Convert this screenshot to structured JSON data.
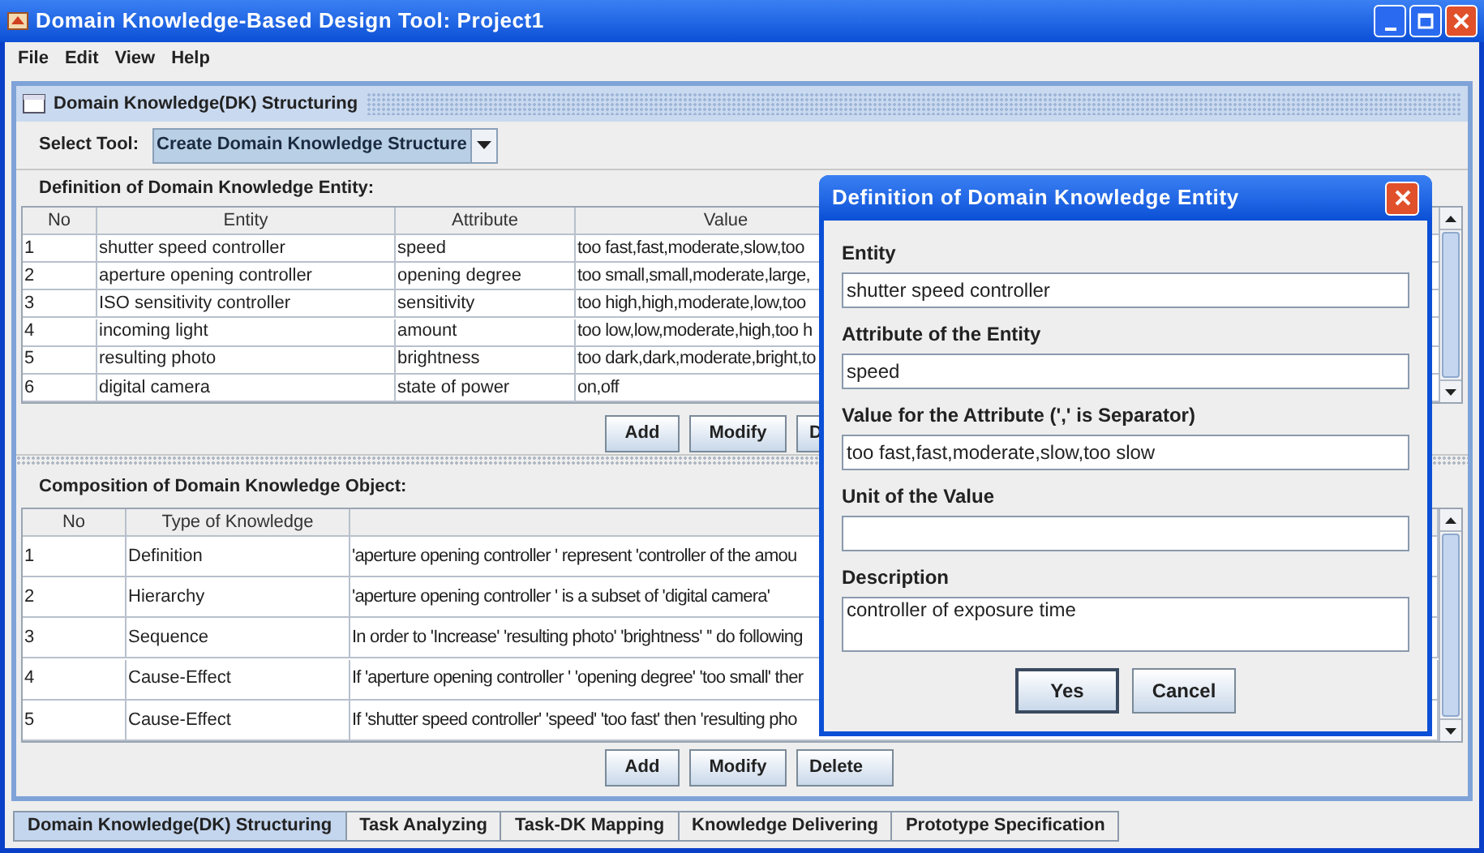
{
  "window": {
    "title": "Domain Knowledge-Based Design Tool: Project1"
  },
  "menu": [
    "File",
    "Edit",
    "View",
    "Help"
  ],
  "internal_frame": {
    "title": "Domain Knowledge(DK) Structuring"
  },
  "select_tool": {
    "label": "Select Tool:",
    "value": "Create Domain Knowledge Structure"
  },
  "entity_table": {
    "heading": "Definition of Domain Knowledge Entity:",
    "columns": [
      "No",
      "Entity",
      "Attribute",
      "Value"
    ],
    "rows": [
      [
        "1",
        "shutter speed controller",
        "speed",
        "too fast,fast,moderate,slow,too"
      ],
      [
        "2",
        "aperture opening controller",
        "opening degree",
        "too small,small,moderate,large,"
      ],
      [
        "3",
        "ISO sensitivity controller",
        "sensitivity",
        "too high,high,moderate,low,too"
      ],
      [
        "4",
        "incoming light",
        "amount",
        "too low,low,moderate,high,too h"
      ],
      [
        "5",
        "resulting photo",
        "brightness",
        "too dark,dark,moderate,bright,to"
      ],
      [
        "6",
        "digital camera",
        "state of power",
        "on,off"
      ]
    ],
    "buttons": [
      "Add",
      "Modify",
      "D"
    ]
  },
  "composition_table": {
    "heading": "Composition of Domain Knowledge Object:",
    "columns": [
      "No",
      "Type of Knowledge"
    ],
    "rows": [
      [
        "1",
        "Definition",
        "'aperture opening controller ' represent 'controller of the amou"
      ],
      [
        "2",
        "Hierarchy",
        "'aperture opening controller ' is a subset of 'digital camera'"
      ],
      [
        "3",
        "Sequence",
        "In order to 'Increase' 'resulting photo' 'brightness' '' do following"
      ],
      [
        "4",
        "Cause-Effect",
        "If 'aperture opening controller ' 'opening degree' 'too small' ther"
      ],
      [
        "5",
        "Cause-Effect",
        "If 'shutter speed controller' 'speed' 'too fast' then 'resulting pho"
      ]
    ],
    "buttons": [
      "Add",
      "Modify",
      "Delete"
    ]
  },
  "tabs": [
    {
      "label": "Domain Knowledge(DK) Structuring",
      "selected": true
    },
    {
      "label": "Task Analyzing",
      "selected": false
    },
    {
      "label": "Task-DK Mapping",
      "selected": false
    },
    {
      "label": "Knowledge Delivering",
      "selected": false
    },
    {
      "label": "Prototype Specification",
      "selected": false
    }
  ],
  "dialog": {
    "title": "Definition of Domain Knowledge Entity",
    "fields": [
      {
        "label": "Entity",
        "value": "shutter speed controller",
        "kind": "line"
      },
      {
        "label": "Attribute of the Entity",
        "value": "speed",
        "kind": "line"
      },
      {
        "label": "Value for the Attribute (',' is Separator)",
        "value": "too fast,fast,moderate,slow,too slow",
        "kind": "line"
      },
      {
        "label": "Unit of the Value",
        "kind": "line"
      },
      {
        "label": "Description",
        "value": "controller of exposure time",
        "kind": "area"
      }
    ],
    "buttons": [
      {
        "label": "Yes",
        "focused": true
      },
      {
        "label": "Cancel",
        "focused": false
      }
    ]
  }
}
